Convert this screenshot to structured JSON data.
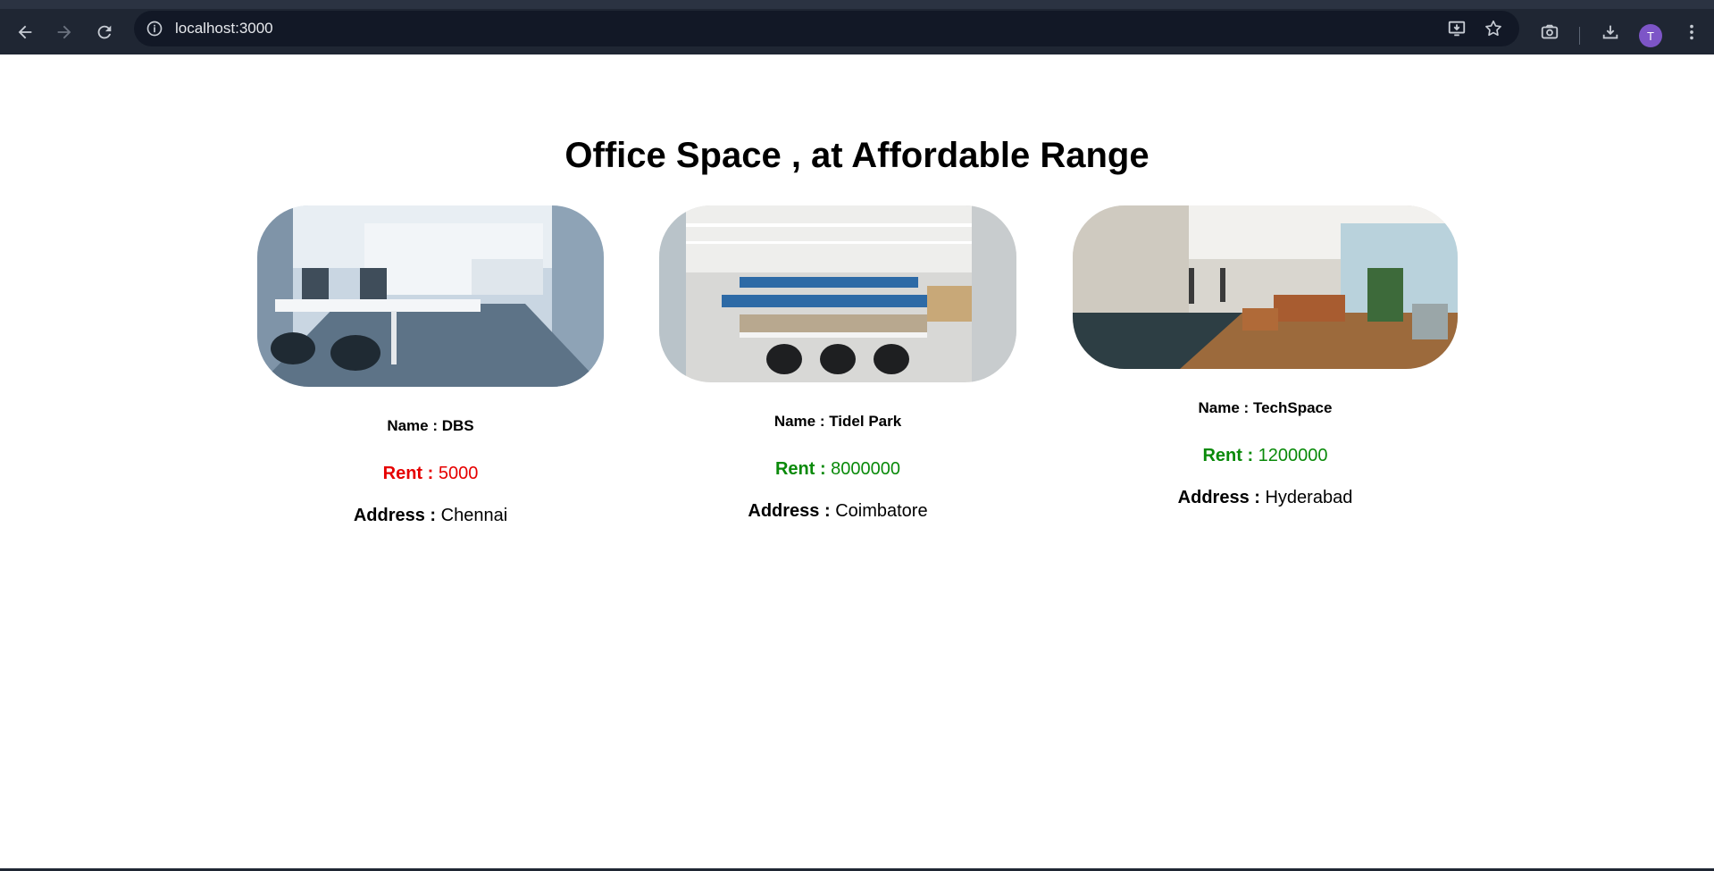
{
  "browser": {
    "url": "localhost:3000",
    "avatar_initial": "T"
  },
  "page": {
    "title": "Office Space , at Affordable Range"
  },
  "offices": [
    {
      "name_label": "Name : ",
      "name": "DBS",
      "rent_label": "Rent : ",
      "rent": "5000",
      "rent_color": "#e60000",
      "address_label": "Address : ",
      "address": "Chennai"
    },
    {
      "name_label": "Name : ",
      "name": "Tidel Park",
      "rent_label": "Rent : ",
      "rent": "8000000",
      "rent_color": "#0a8a0a",
      "address_label": "Address : ",
      "address": "Coimbatore"
    },
    {
      "name_label": "Name : ",
      "name": "TechSpace",
      "rent_label": "Rent : ",
      "rent": "1200000",
      "rent_color": "#0a8a0a",
      "address_label": "Address : ",
      "address": "Hyderabad"
    }
  ]
}
